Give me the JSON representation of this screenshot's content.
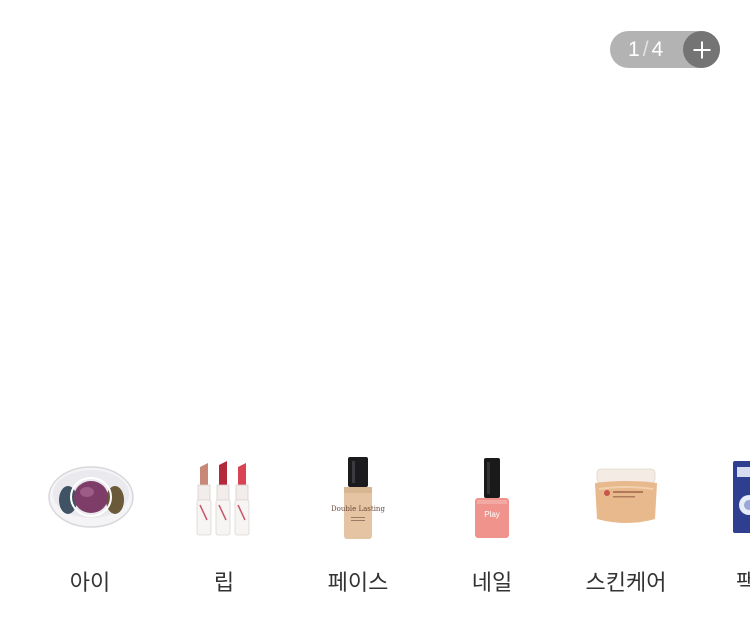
{
  "pager": {
    "current": "1",
    "separator": "/",
    "total": "4"
  },
  "categories": [
    {
      "label": "아이"
    },
    {
      "label": "립"
    },
    {
      "label": "페이스"
    },
    {
      "label": "네일"
    },
    {
      "label": "스킨케어"
    },
    {
      "label": "팩/마"
    }
  ],
  "product_text": {
    "foundation_brand": "Double Lasting",
    "nail_brand": "Play"
  }
}
